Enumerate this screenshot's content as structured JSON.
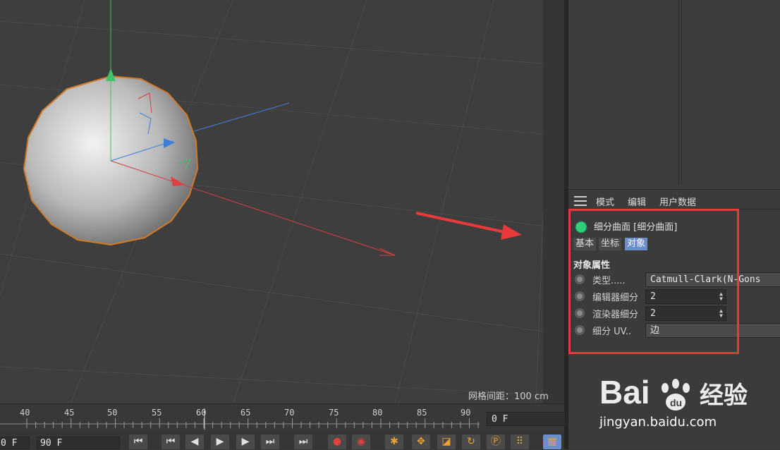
{
  "viewport": {
    "grid_readout": "网格间距：100 cm"
  },
  "attributes": {
    "menu": [
      "模式",
      "编辑",
      "用户数据"
    ],
    "object_title": "细分曲面 [细分曲面]",
    "tabs": [
      {
        "label": "基本",
        "active": false
      },
      {
        "label": "坐标",
        "active": false
      },
      {
        "label": "对象",
        "active": true
      }
    ],
    "section_title": "对象属性",
    "rows": [
      {
        "label": "类型.....",
        "value": "Catmull-Clark(N-Gons"
      },
      {
        "label": "编辑器细分",
        "value": "2"
      },
      {
        "label": "渲染器细分",
        "value": "2"
      },
      {
        "label": "细分 UV..",
        "value": "边"
      }
    ],
    "highlight_color": "#e8393b"
  },
  "timeline": {
    "ticks": [
      "40",
      "45",
      "50",
      "55",
      "60",
      "65",
      "70",
      "75",
      "80",
      "85",
      "90"
    ],
    "current_frame": "0 F",
    "start_field": "0 F",
    "end_field": "90 F"
  },
  "watermark": {
    "logo_text": "Bai du 经验",
    "url": "jingyan.baidu.com"
  }
}
